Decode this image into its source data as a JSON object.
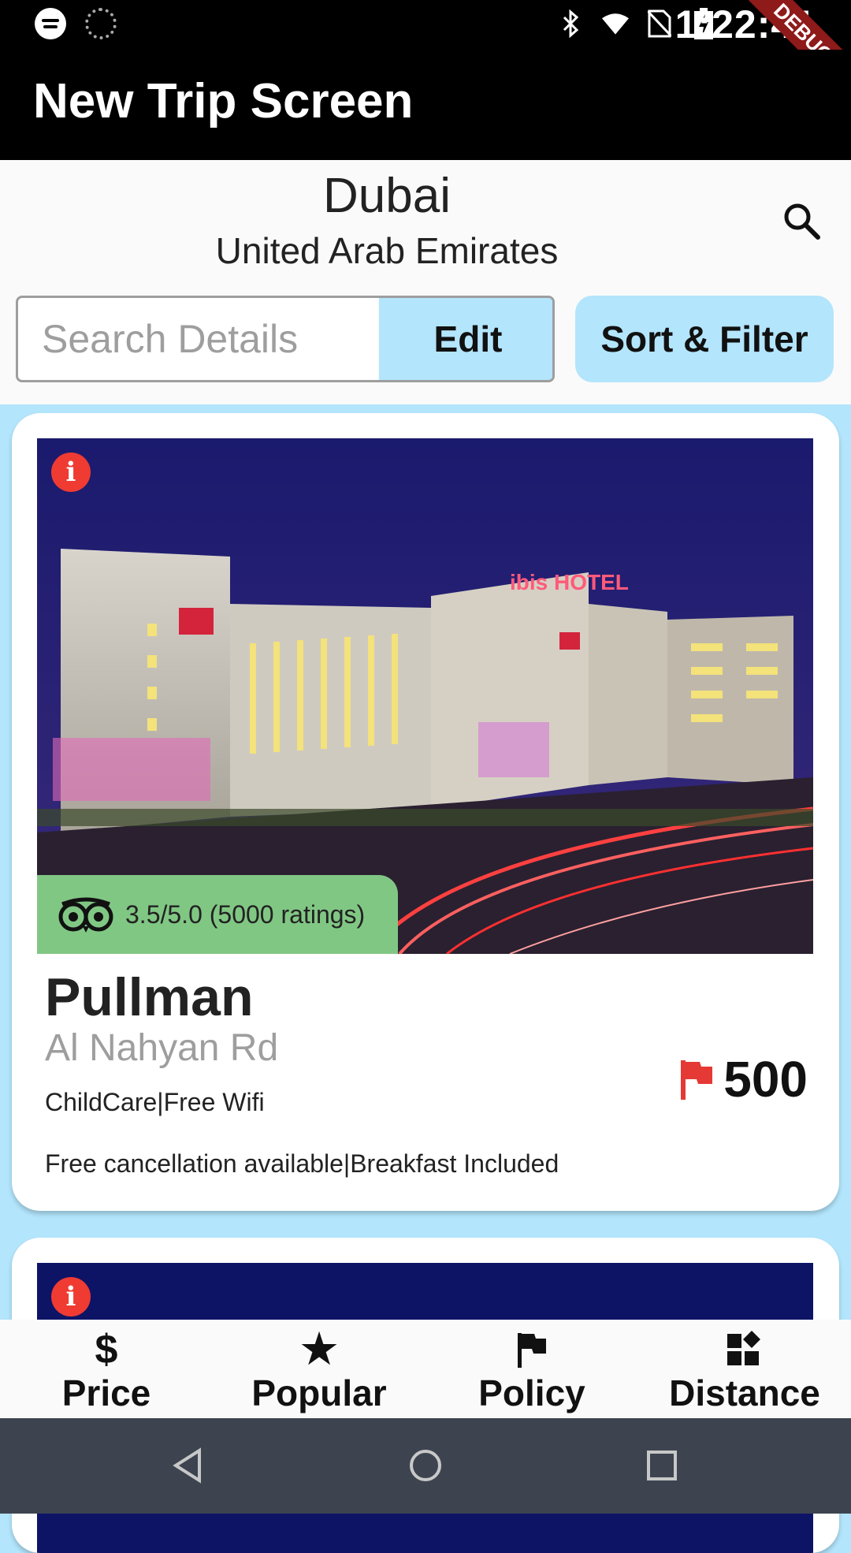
{
  "status_bar": {
    "time": "1:22:41",
    "debug_label": "DEBUG"
  },
  "app_bar": {
    "title": "New Trip Screen"
  },
  "destination": {
    "city": "Dubai",
    "country": "United Arab Emirates"
  },
  "search": {
    "placeholder": "Search Details",
    "edit_label": "Edit",
    "sort_filter_label": "Sort & Filter"
  },
  "hotels": [
    {
      "name": "Pullman",
      "address": "Al Nahyan Rd",
      "amenities": "ChildCare|Free Wifi",
      "policies": "Free cancellation available|Breakfast Included",
      "price": "500",
      "rating": "3.5/5.0 (5000 ratings)",
      "sign_text": "ibis HOTEL"
    }
  ],
  "bottom_nav": [
    {
      "label": "Price",
      "icon": "dollar-icon",
      "glyph": "$"
    },
    {
      "label": "Popular",
      "icon": "star-icon",
      "glyph": "★"
    },
    {
      "label": "Policy",
      "icon": "flag-icon",
      "glyph": ""
    },
    {
      "label": "Distance",
      "icon": "widgets-icon",
      "glyph": ""
    }
  ],
  "colors": {
    "accent": "#b3e5fc",
    "rating_badge": "#81c784",
    "info_red": "#ef3b32",
    "flag_red": "#e53935"
  }
}
